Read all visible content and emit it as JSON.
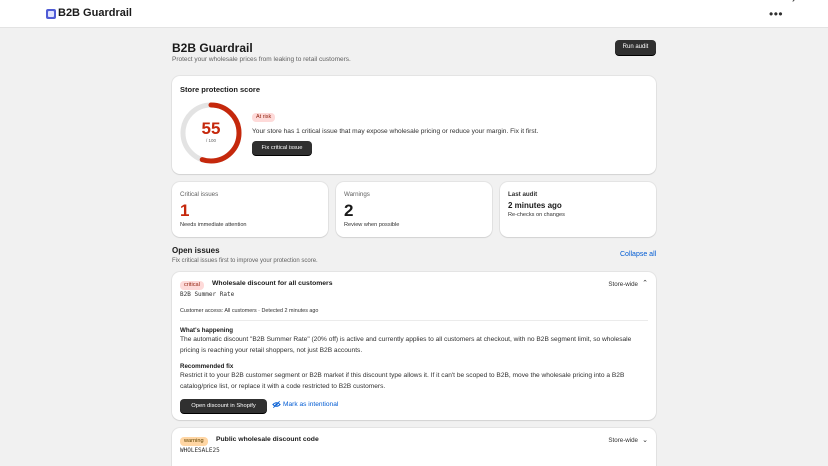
{
  "app": {
    "name": "B2B Guardrail"
  },
  "header": {
    "title": "B2B Guardrail",
    "subtitle": "Protect your wholesale prices from leaking to retail customers.",
    "run_audit_label": "Run audit"
  },
  "score": {
    "title": "Store protection score",
    "value": "55",
    "max": "/ 100",
    "value_fraction": 0.55,
    "status_badge": "At risk",
    "message": "Your store has 1 critical issue that may expose wholesale pricing or reduce your margin. Fix it first.",
    "fix_label": "Fix critical issue",
    "colors": {
      "score": "#c5280c",
      "track": "#e3e3e3"
    }
  },
  "stats": {
    "critical": {
      "label": "Critical issues",
      "value": "1",
      "note": "Needs immediate attention"
    },
    "warnings": {
      "label": "Warnings",
      "value": "2",
      "note": "Review when possible"
    },
    "last_audit": {
      "label": "Last audit",
      "value": "2 minutes ago",
      "note": "Re-checks on changes"
    }
  },
  "open_issues": {
    "title": "Open issues",
    "subtitle": "Fix critical issues first to improve your protection score.",
    "collapse_label": "Collapse all"
  },
  "issues": [
    {
      "severity": "critical",
      "title": "Wholesale discount for all customers",
      "code": "B2B Summer Rate",
      "scope": "Store-wide",
      "meta": "Customer access: All customers · Detected 2 minutes ago",
      "whats_happening_label": "What's happening",
      "whats_happening": "The automatic discount \"B2B Summer Rate\" (20% off) is active and currently applies to all customers at checkout, with no B2B segment limit, so wholesale pricing is reaching your retail shoppers, not just B2B accounts.",
      "fix_label": "Recommended fix",
      "fix": "Restrict it to your B2B customer segment or B2B market if this discount type allows it. If it can't be scoped to B2B, move the wholesale pricing into a B2B catalog/price list, or replace it with a code restricted to B2B customers.",
      "primary_action": "Open discount in Shopify",
      "secondary_action": "Mark as intentional"
    },
    {
      "severity": "warning",
      "title": "Public wholesale discount code",
      "code": "WHOLESALE25",
      "scope": "Store-wide"
    }
  ],
  "icons": {
    "app": "app-logo-icon",
    "more": "more-horizontal-icon",
    "chevron_up": "chevron-up-icon",
    "chevron_down": "chevron-down-icon",
    "eye_off": "eye-off-icon"
  }
}
